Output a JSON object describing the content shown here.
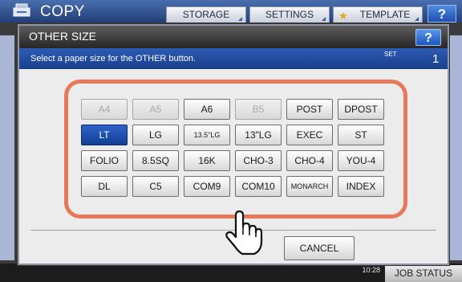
{
  "app": {
    "title": "COPY",
    "tabs": [
      "STORAGE",
      "SETTINGS",
      "TEMPLATE"
    ],
    "help": "?",
    "job_status": "JOB STATUS",
    "time": "10:28"
  },
  "dialog": {
    "title": "OTHER SIZE",
    "help": "?",
    "message": "Select a paper size for the OTHER button.",
    "set_label": "SET",
    "set_count": "1",
    "sizes": [
      {
        "label": "A4",
        "state": "disabled"
      },
      {
        "label": "A5",
        "state": "disabled"
      },
      {
        "label": "A6",
        "state": "normal"
      },
      {
        "label": "B5",
        "state": "disabled"
      },
      {
        "label": "POST",
        "state": "normal"
      },
      {
        "label": "DPOST",
        "state": "normal"
      },
      {
        "label": "LT",
        "state": "selected"
      },
      {
        "label": "LG",
        "state": "normal"
      },
      {
        "label": "13.5\"LG",
        "state": "normal"
      },
      {
        "label": "13\"LG",
        "state": "normal"
      },
      {
        "label": "EXEC",
        "state": "normal"
      },
      {
        "label": "ST",
        "state": "normal"
      },
      {
        "label": "FOLIO",
        "state": "normal"
      },
      {
        "label": "8.5SQ",
        "state": "normal"
      },
      {
        "label": "16K",
        "state": "normal"
      },
      {
        "label": "CHO-3",
        "state": "normal"
      },
      {
        "label": "CHO-4",
        "state": "normal"
      },
      {
        "label": "YOU-4",
        "state": "normal"
      },
      {
        "label": "DL",
        "state": "normal"
      },
      {
        "label": "C5",
        "state": "normal"
      },
      {
        "label": "COM9",
        "state": "normal"
      },
      {
        "label": "COM10",
        "state": "normal"
      },
      {
        "label": "MONARCH",
        "state": "normal"
      },
      {
        "label": "INDEX",
        "state": "normal"
      }
    ],
    "cancel_label": "CANCEL"
  },
  "colors": {
    "frame_highlight": "#e8785a",
    "selected_button": "#1f4fa8",
    "info_bar": "#1f4a9e"
  },
  "icons": {
    "copy": "copy-machine-icon",
    "template": "star-icon",
    "pointer": "hand-pointer-icon"
  }
}
